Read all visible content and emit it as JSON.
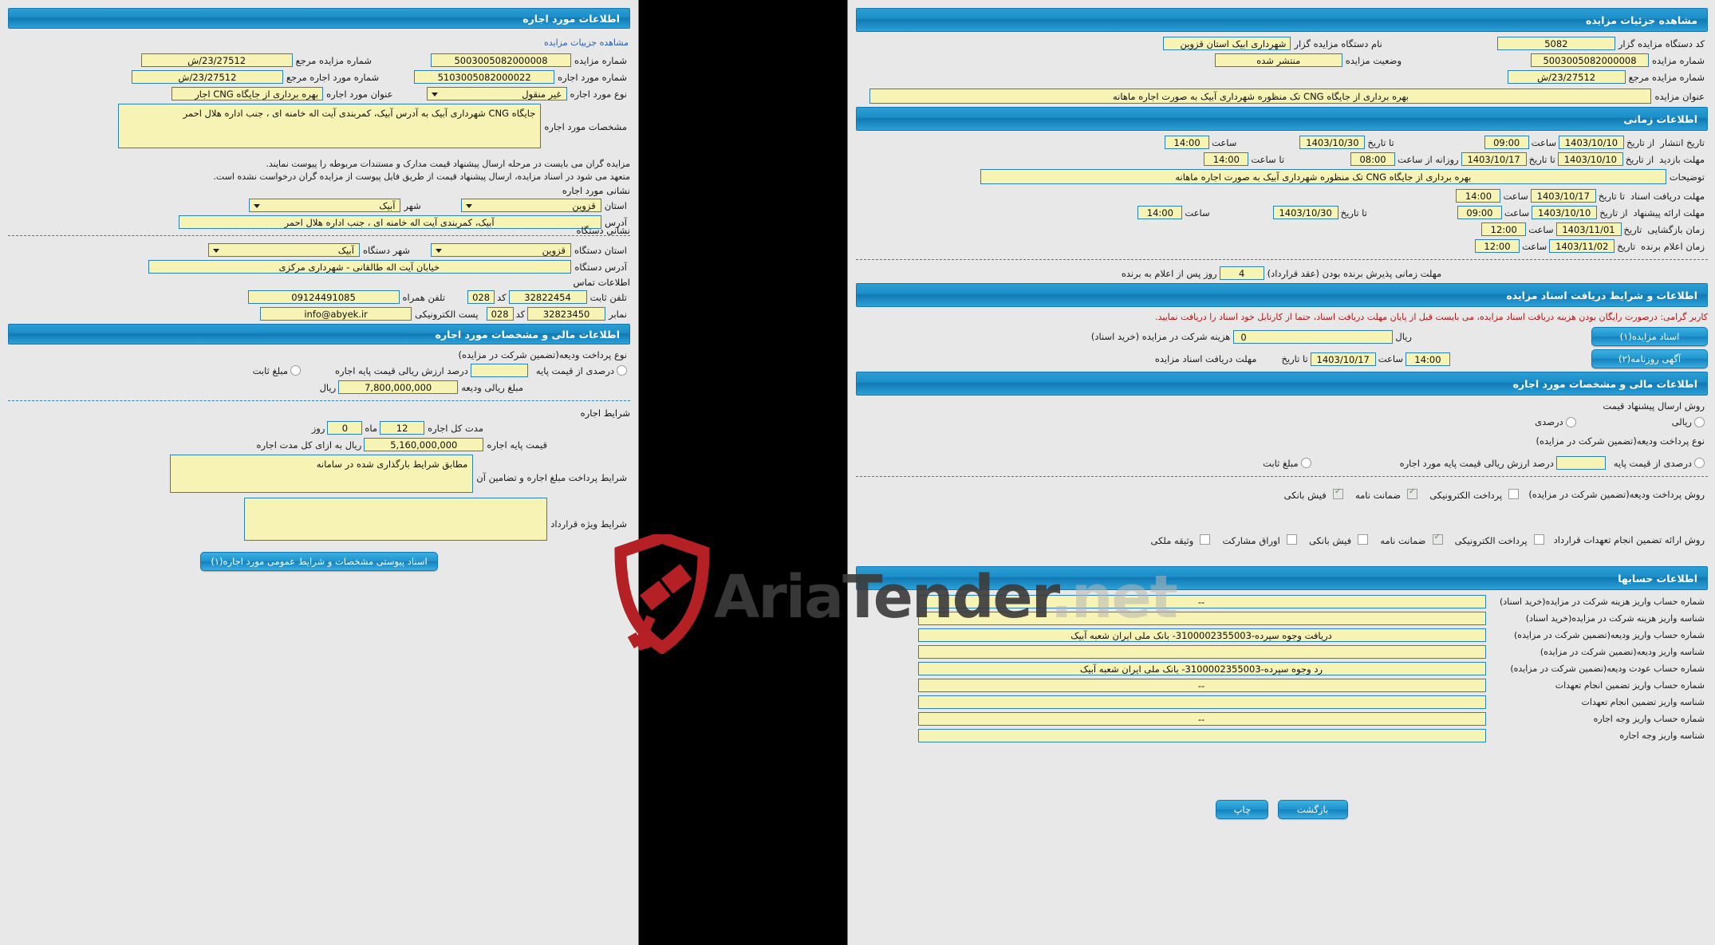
{
  "left": {
    "header": "اطلاعات مورد اجاره",
    "view_details_link": "مشاهده جزییات مزایده",
    "fields": {
      "auction_number_label": "شماره مزایده",
      "auction_number_value": "5003005082000008",
      "ref_auction_number_label": "شماره مزایده مرجع",
      "ref_auction_number_value": "23/27512/ش",
      "lease_number_label": "شماره مورد اجاره",
      "lease_number_value": "5103005082000022",
      "ref_lease_number_label": "شماره مورد اجاره مرجع",
      "ref_lease_number_value": "23/27512/ش",
      "lease_type_label": "نوع مورد اجاره",
      "lease_type_value": "غیر منقول",
      "lease_title_label": "عنوان مورد اجاره",
      "lease_title_value": "بهره برداری از جایگاه CNG اجار",
      "specs_label": "مشخصات مورد اجاره",
      "specs_value": "جایگاه CNG شهرداری آبیک به آدرس آبیک، کمربندی آیت اله خامنه ای ، جنب اداره هلال احمر"
    },
    "notes": [
      "مزایده گران می بایست در مرحله ارسال پیشنهاد قیمت مدارک و مستندات مربوطه را پیوست نمایند.",
      "متعهد می شود در اسناد مزایده، ارسال پیشنهاد قیمت از طریق فایل پیوست از مزایده گران درخواست نشده است."
    ],
    "lease_address": {
      "group_title": "نشانی مورد اجاره",
      "province_label": "استان",
      "province_value": "قزوین",
      "city_label": "شهر",
      "city_value": "آبیک",
      "address_label": "آدرس",
      "address_value": "آبیک، کمربندی آیت اله خامنه ای ، جنب اداره هلال احمر"
    },
    "org_address": {
      "group_title": "نشانی دستگاه",
      "province_label": "استان دستگاه",
      "province_value": "قزوین",
      "city_label": "شهر دستگاه",
      "city_value": "آبیک",
      "address_label": "آدرس دستگاه",
      "address_value": "خیابان آیت اله طالقانی - شهرداری مرکزی"
    },
    "contact": {
      "group_title": "اطلاعات تماس",
      "phone_label": "تلفن ثابت",
      "phone_value": "32822454",
      "phone_code_label": "کد",
      "phone_code_value": "028",
      "mobile_label": "تلفن همراه",
      "mobile_value": "09124491085",
      "fax_label": "نمابر",
      "fax_value": "32823450",
      "fax_code_label": "کد",
      "fax_code_value": "028",
      "email_label": "پست الکترونیکی",
      "email_value": "info@abyek.ir"
    },
    "financial": {
      "header": "اطلاعات مالی و مشخصات مورد اجاره",
      "deposit_type_label": "نوع پرداخت ودیعه(تضمین شرکت در مزایده)",
      "opt_percent_of_base": "درصدی از قیمت پایه",
      "percent_field_label": "درصد ارزش ریالی قیمت پایه اجاره",
      "percent_field_value": "",
      "opt_fixed_amount": "مبلغ ثابت",
      "deposit_amount_label": "مبلغ ریالی ودیعه",
      "deposit_amount_value": "7,800,000,000",
      "rial_label": "ریال"
    },
    "lease_terms": {
      "group_title": "شرایط اجاره",
      "duration_label": "مدت کل اجاره",
      "duration_months": "12",
      "months_label": "ماه",
      "duration_days": "0",
      "days_label": "روز",
      "base_price_label": "قیمت پایه اجاره",
      "base_price_value": "5,160,000,000",
      "base_price_suffix": "ریال به ازای کل مدت اجاره",
      "payment_terms_label": "شرایط پرداخت مبلغ اجاره و تضامین آن",
      "payment_terms_value": "مطابق شرایط بارگذاری شده در سامانه",
      "special_terms_label": "شرایط ویژه قرارداد",
      "special_terms_value": ""
    },
    "attachment_button": "اسناد پیوستی مشخصات و شرایط عمومی مورد اجاره(۱)"
  },
  "right": {
    "header": "مشاهده جزئیات مزایده",
    "summary": {
      "org_code_label": "کد دستگاه مزایده گزار",
      "org_code_value": "5082",
      "org_name_label": "نام دستگاه مزایده گزار",
      "org_name_value": "شهرداری ابیک استان قزوین",
      "auction_number_label": "شماره مزایده",
      "auction_number_value": "5003005082000008",
      "status_label": "وضعیت مزایده",
      "status_value": "منتشر شده",
      "ref_number_label": "شماره مزایده مرجع",
      "ref_number_value": "23/27512/ش",
      "title_label": "عنوان مزایده",
      "title_value": "بهره برداری از جایگاه CNG  تک منظوره شهرداری آبیک به صورت اجاره ماهانه"
    },
    "time_info": {
      "header": "اطلاعات زمانی",
      "publish_label": "تاریخ انتشار",
      "from_date_label": "از تاریخ",
      "publish_from_date": "1403/10/10",
      "hour_label": "ساعت",
      "publish_from_time": "09:00",
      "to_date_label": "تا تاریخ",
      "publish_to_date": "1403/10/30",
      "publish_to_time": "14:00",
      "visit_label": "مهلت بازدید",
      "visit_from_date": "1403/10/10",
      "visit_to_date": "1403/10/17",
      "visit_daily_label": "روزانه از ساعت",
      "visit_daily_from": "08:00",
      "visit_until_hour_label": "تا ساعت",
      "visit_daily_to": "14:00",
      "description_label": "توضیحات",
      "description_value": "بهره برداری از جایگاه CNG  تک منظوره شهرداری آبیک به صورت اجاره ماهانه",
      "docs_deadline_label": "مهلت دریافت اسناد",
      "docs_to_date_label": "تا تاریخ",
      "docs_to_date": "1403/10/17",
      "docs_to_time": "14:00",
      "offer_deadline_label": "مهلت ارائه پیشنهاد",
      "offer_from_date": "1403/10/10",
      "offer_from_time": "09:00",
      "offer_to_date": "1403/10/30",
      "offer_to_time": "14:00",
      "opening_label": "زمان بازگشایی",
      "date_label": "تاریخ",
      "opening_date": "1403/11/01",
      "opening_time": "12:00",
      "winner_label": "زمان اعلام برنده",
      "winner_date": "1403/11/02",
      "winner_time": "12:00",
      "acceptance_label": "مهلت زمانی پذیرش برنده بودن (عقد قرارداد)",
      "acceptance_days": "4",
      "acceptance_suffix": "روز پس از اعلام به برنده"
    },
    "docs_info": {
      "header": "اطلاعات و شرایط دریافت اسناد مزایده",
      "warning": "کاربر گرامی: درصورت رایگان بودن هزینه دریافت اسناد مزایده، می بایست قبل از پایان مهلت دریافت اسناد، حتما از کارتابل خود اسناد را دریافت نمایید.",
      "fee_label": "هزینه شرکت در مزایده (خرید اسناد)",
      "fee_value": "0",
      "rial_label": "ریال",
      "docs_button": "اسناد مزایده(۱)",
      "deadline_label": "مهلت دریافت اسناد مزایده",
      "to_date_label": "تا تاریخ",
      "deadline_date": "1403/10/17",
      "hour_label": "ساعت",
      "deadline_time": "14:00",
      "newspaper_button": "آگهی روزنامه(۲)"
    },
    "financial": {
      "header": "اطلاعات مالی و مشخصات مورد اجاره",
      "price_method_label": "روش ارسال پیشنهاد قیمت",
      "opt_rial": "ریالی",
      "opt_percent": "درصدی",
      "deposit_type_label": "نوع پرداخت ودیعه(تضمین شرکت در مزایده)",
      "opt_percent_of_base": "درصدی از قیمت پایه",
      "percent_field_label": "درصد ارزش ریالی قیمت پایه مورد اجاره",
      "percent_field_value": "",
      "opt_fixed_amount": "مبلغ ثابت",
      "deposit_method_label": "روش پرداخت ودیعه(تضمین شرکت در مزایده)",
      "deposit_methods": [
        {
          "label": "پرداخت الکترونیکی",
          "checked": false
        },
        {
          "label": "ضمانت نامه",
          "checked": true
        },
        {
          "label": "فیش بانکی",
          "checked": true
        }
      ],
      "guarantee_method_label": "روش ارائه تضمین انجام تعهدات قرارداد",
      "guarantee_methods": [
        {
          "label": "پرداخت الکترونیکی",
          "checked": false
        },
        {
          "label": "ضمانت نامه",
          "checked": true
        },
        {
          "label": "فیش بانکی",
          "checked": false
        },
        {
          "label": "اوراق مشارکت",
          "checked": false
        },
        {
          "label": "وثیقه ملکی",
          "checked": false
        }
      ]
    },
    "accounts": {
      "header": "اطلاعات حسابها",
      "rows": [
        {
          "label": "شماره حساب واریز هزینه شرکت در مزایده(خرید اسناد)",
          "value": "--"
        },
        {
          "label": "شناسه واریز هزینه شرکت در مزایده(خرید اسناد)",
          "value": ""
        },
        {
          "label": "شماره حساب واریز ودیعه(تضمین شرکت در مزایده)",
          "value": "دریافت وجوه سپرده-3100002355003- بانک ملی ایران شعبه آبیک"
        },
        {
          "label": "شناسه واریز ودیعه(تضمین شرکت در مزایده)",
          "value": ""
        },
        {
          "label": "شماره حساب عودت ودیعه(تضمین شرکت در مزایده)",
          "value": "رد وجوه سپرده-3100002355003- بانک ملی ایران شعبه آبیک"
        },
        {
          "label": "شماره حساب واریز تضمین انجام تعهدات",
          "value": "--"
        },
        {
          "label": "شناسه واریز تضمین انجام تعهدات",
          "value": ""
        },
        {
          "label": "شماره حساب واریز وجه اجاره",
          "value": "--"
        },
        {
          "label": "شناسه واریز وجه اجاره",
          "value": ""
        }
      ]
    },
    "footer": {
      "back_button": "بازگشت",
      "print_button": "چاپ"
    }
  },
  "watermark": {
    "brand_dark": "AriaTender",
    "brand_light": ".net",
    "icon": "shield-gavel-logo"
  }
}
